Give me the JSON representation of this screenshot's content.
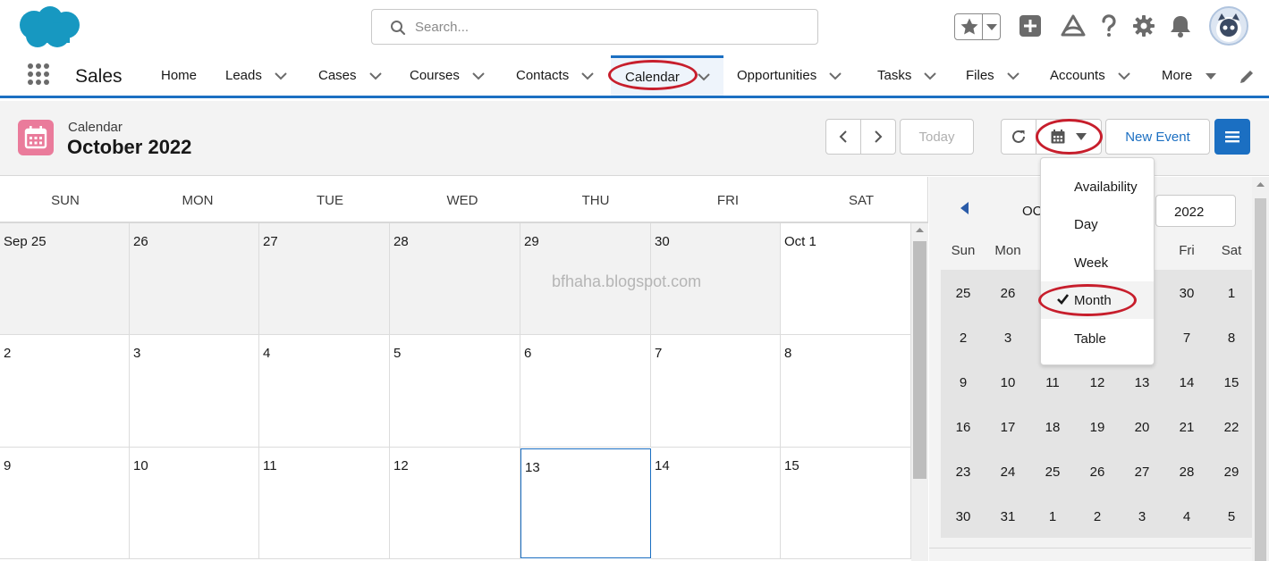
{
  "header": {
    "search_placeholder": "Search..."
  },
  "nav": {
    "app_name": "Sales",
    "items": [
      {
        "label": "Home",
        "has_menu": false
      },
      {
        "label": "Leads",
        "has_menu": true
      },
      {
        "label": "Cases",
        "has_menu": true
      },
      {
        "label": "Courses",
        "has_menu": true
      },
      {
        "label": "Contacts",
        "has_menu": true
      },
      {
        "label": "Calendar",
        "has_menu": true,
        "active": true
      },
      {
        "label": "Opportunities",
        "has_menu": true
      },
      {
        "label": "Tasks",
        "has_menu": true
      },
      {
        "label": "Files",
        "has_menu": true
      },
      {
        "label": "Accounts",
        "has_menu": true
      },
      {
        "label": "More",
        "has_menu": true
      }
    ]
  },
  "page": {
    "object_label": "Calendar",
    "title": "October 2022",
    "today_button": "Today",
    "new_event_button": "New Event"
  },
  "grid": {
    "weekdays": [
      "SUN",
      "MON",
      "TUE",
      "WED",
      "THU",
      "FRI",
      "SAT"
    ],
    "weeks": [
      [
        "Sep 25",
        "26",
        "27",
        "28",
        "29",
        "30",
        "Oct 1"
      ],
      [
        "2",
        "3",
        "4",
        "5",
        "6",
        "7",
        "8"
      ],
      [
        "9",
        "10",
        "11",
        "12",
        "13",
        "14",
        "15"
      ]
    ],
    "today": "13"
  },
  "mini_calendar": {
    "month_partial": "OC",
    "year": "2022",
    "weekdays": [
      "Sun",
      "Mon",
      "",
      "",
      "",
      "Fri",
      "Sat"
    ],
    "weeks": [
      [
        "25",
        "26",
        "",
        "",
        "",
        "30",
        "1"
      ],
      [
        "2",
        "3",
        "",
        "",
        "",
        "7",
        "8"
      ],
      [
        "9",
        "10",
        "11",
        "12",
        "13",
        "14",
        "15"
      ],
      [
        "16",
        "17",
        "18",
        "19",
        "20",
        "21",
        "22"
      ],
      [
        "23",
        "24",
        "25",
        "26",
        "27",
        "28",
        "29"
      ],
      [
        "30",
        "31",
        "1",
        "2",
        "3",
        "4",
        "5"
      ]
    ]
  },
  "view_menu": {
    "items": [
      "Availability",
      "Day",
      "Week",
      "Month",
      "Table"
    ],
    "selected": "Month"
  },
  "watermark": "bfhaha.blogspot.com",
  "colors": {
    "brand_blue": "#1b6fc2",
    "calendar_icon": "#ea7b9b",
    "annotation_red": "#c71e2c"
  }
}
